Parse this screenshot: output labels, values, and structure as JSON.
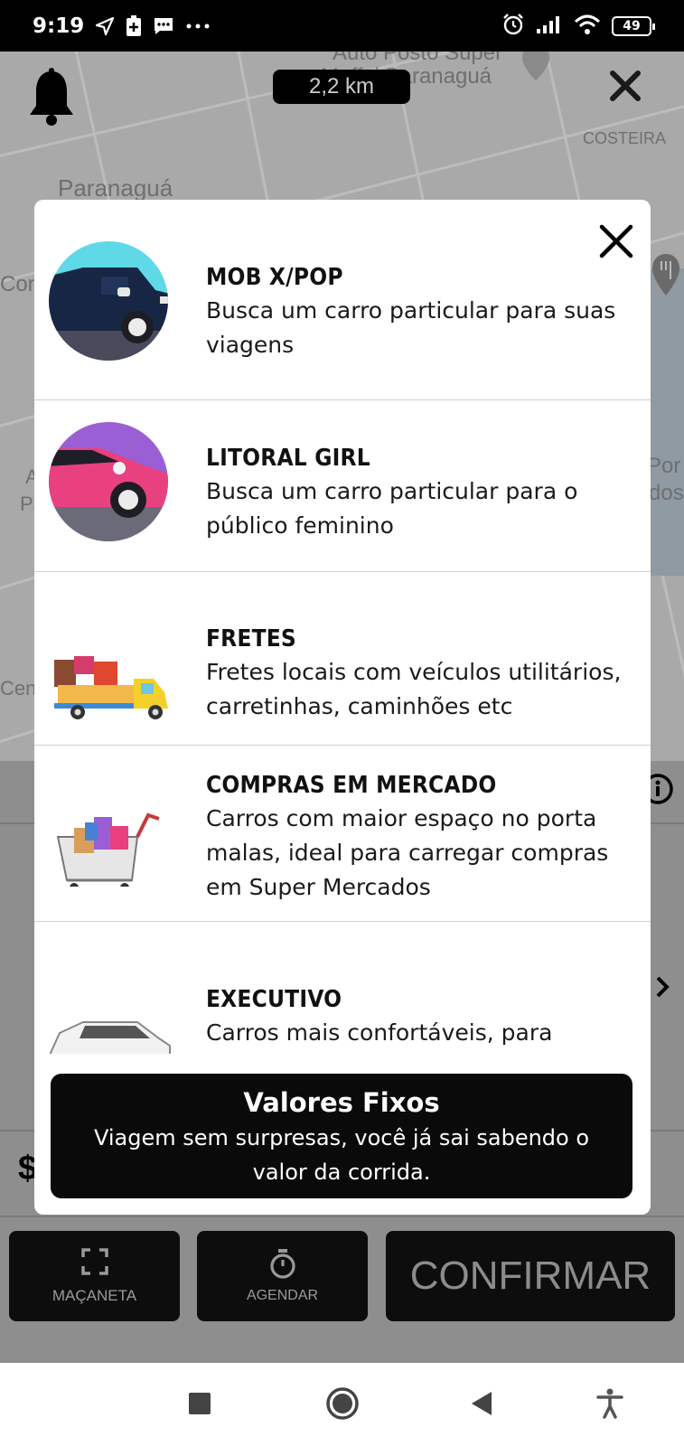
{
  "status_bar": {
    "time": "9:19",
    "battery": "49",
    "icons": [
      "navigation-icon",
      "battery-saver-icon",
      "message-icon",
      "more-dots-icon",
      "alarm-icon",
      "signal-icon",
      "wifi-icon",
      "battery-icon"
    ]
  },
  "map": {
    "distance": "2,2 km",
    "labels": {
      "auto_posto": "Auto Posto Super",
      "auto_posto_2": "Maffei Paranaguá",
      "paranagua": "Paranaguá",
      "costeira": "COSTEIRA",
      "con": "Con",
      "por": "Por",
      "dos": "dos",
      "a": "A",
      "pa": "Pa",
      "cen": "Cen"
    }
  },
  "modal": {
    "options": [
      {
        "title": "MOB X/POP",
        "description": "Busca um carro particular para suas viagens",
        "icon": "dark-car-icon"
      },
      {
        "title": "LITORAL GIRL",
        "description": "Busca um carro particular para o público feminino",
        "icon": "pink-car-icon"
      },
      {
        "title": "FRETES",
        "description": "Fretes locais com veículos utilitários, carretinhas, caminhões etc",
        "icon": "truck-icon"
      },
      {
        "title": "COMPRAS EM MERCADO",
        "description": "Carros com maior espaço no porta malas, ideal para carregar compras em Super Mercados",
        "icon": "shopping-cart-icon"
      },
      {
        "title": "EXECUTIVO",
        "description": "Carros mais confortáveis, para clientes",
        "icon": "suv-icon"
      }
    ],
    "banner": {
      "title": "Valores Fixos",
      "description": "Viagem sem surpresas, você já sai sabendo o valor da corrida."
    }
  },
  "bottom_bar": {
    "macaneta": "MAÇANETA",
    "agendar": "AGENDAR",
    "confirmar": "CONFIRMAR",
    "price_prefix": "$"
  },
  "colors": {
    "modal_bg": "#ffffff",
    "banner_bg": "#0a0a0a",
    "dim_bg": "#9a9a9a"
  }
}
